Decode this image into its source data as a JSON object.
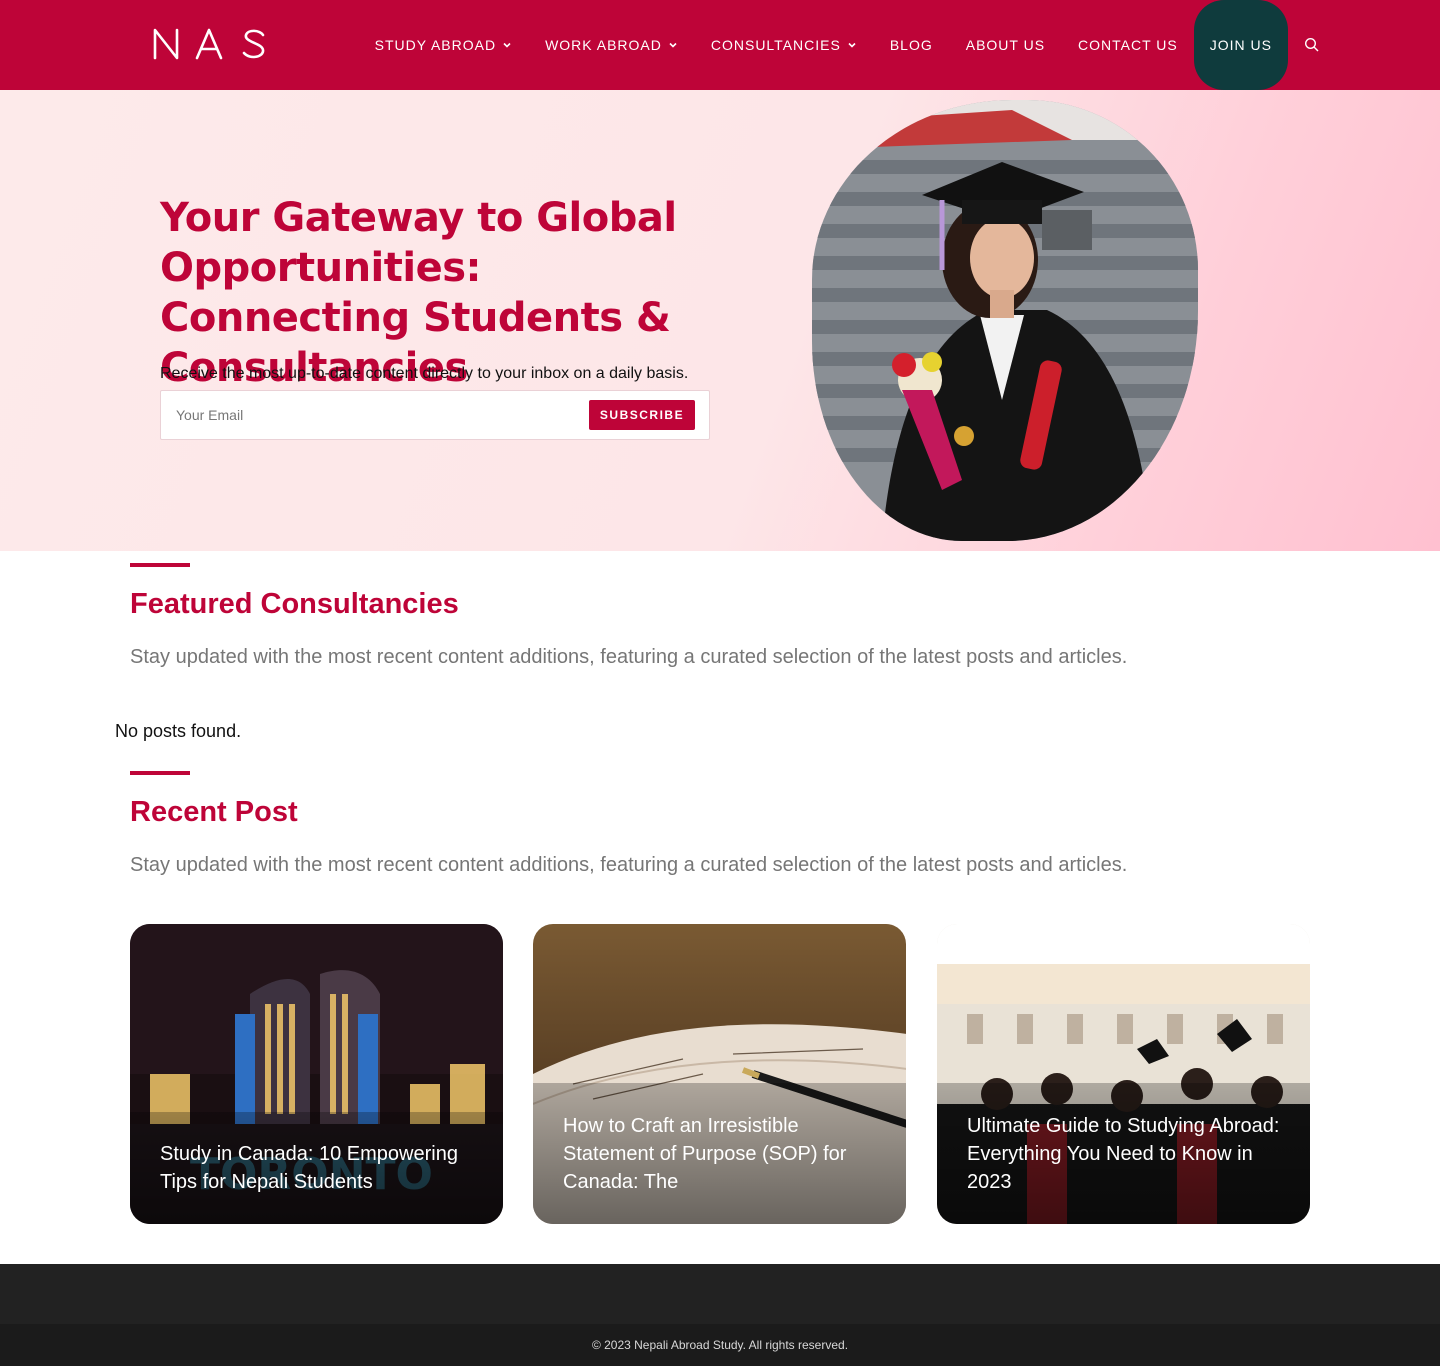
{
  "brand": {
    "logo_text": "NAS",
    "primary_color": "#be0438",
    "join_color": "#0f3b3d"
  },
  "nav": {
    "items": [
      {
        "label": "STUDY ABROAD",
        "has_dropdown": true
      },
      {
        "label": "WORK ABROAD",
        "has_dropdown": true
      },
      {
        "label": "CONSULTANCIES",
        "has_dropdown": true
      },
      {
        "label": "BLOG",
        "has_dropdown": false
      },
      {
        "label": "ABOUT US",
        "has_dropdown": false
      },
      {
        "label": "CONTACT US",
        "has_dropdown": false
      }
    ],
    "join_label": "JOIN US",
    "search_icon": "search-icon"
  },
  "hero": {
    "title": "Your Gateway to Global Opportunities: Connecting Students & Consultancies",
    "subtitle": "Receive the most up-to-date content directly to your inbox on a daily basis.",
    "email_placeholder": "Your Email",
    "subscribe_label": "SUBSCRIBE"
  },
  "featured": {
    "title": "Featured Consultancies",
    "description": "Stay updated with the most recent content additions, featuring a curated selection of the latest posts and articles.",
    "empty_text": "No posts found."
  },
  "recent": {
    "title": "Recent Post",
    "description": "Stay updated with the most recent content additions, featuring a curated selection of the latest posts and articles.",
    "posts": [
      {
        "title": "Study in Canada: 10 Empowering Tips for Nepali Students"
      },
      {
        "title": "How to Craft an Irresistible Statement of Purpose (SOP) for Canada: The"
      },
      {
        "title": "Ultimate Guide to Studying Abroad: Everything You Need to Know in 2023"
      }
    ]
  },
  "footer": {
    "copyright": "© 2023 Nepali Abroad Study. All rights reserved."
  }
}
